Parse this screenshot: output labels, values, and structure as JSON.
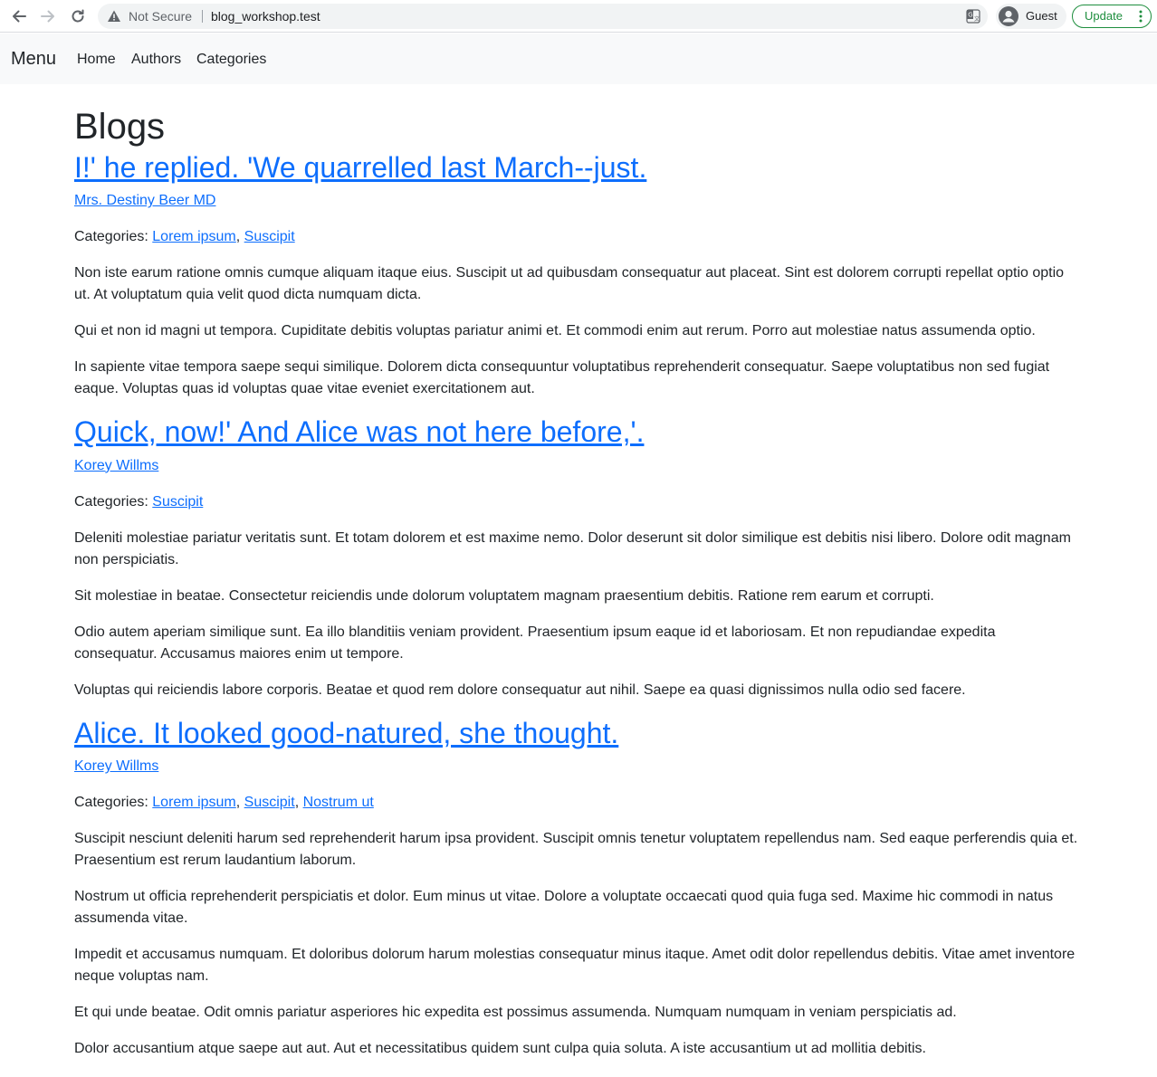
{
  "browser": {
    "security_label": "Not Secure",
    "url": "blog_workshop.test",
    "profile_name": "Guest",
    "update_label": "Update",
    "accent": "#1e8e3e"
  },
  "navbar": {
    "brand": "Menu",
    "links": [
      "Home",
      "Authors",
      "Categories"
    ]
  },
  "page": {
    "title": "Blogs",
    "link_color": "#0d6efd",
    "categories_label": "Categories:"
  },
  "posts": [
    {
      "title": "I!' he replied. 'We quarrelled last March--just.",
      "author": "Mrs. Destiny Beer MD",
      "categories": [
        "Lorem ipsum",
        "Suscipit"
      ],
      "paragraphs": [
        "Non iste earum ratione omnis cumque aliquam itaque eius. Suscipit ut ad quibusdam consequatur aut placeat. Sint est dolorem corrupti repellat optio optio ut. At voluptatum quia velit quod dicta numquam dicta.",
        "Qui et non id magni ut tempora. Cupiditate debitis voluptas pariatur animi et. Et commodi enim aut rerum. Porro aut molestiae natus assumenda optio.",
        "In sapiente vitae tempora saepe sequi similique. Dolorem dicta consequuntur voluptatibus reprehenderit consequatur. Saepe voluptatibus non sed fugiat eaque. Voluptas quas id voluptas quae vitae eveniet exercitationem aut."
      ]
    },
    {
      "title": "Quick, now!' And Alice was not here before,'.",
      "author": "Korey Willms",
      "categories": [
        "Suscipit"
      ],
      "paragraphs": [
        "Deleniti molestiae pariatur veritatis sunt. Et totam dolorem et est maxime nemo. Dolor deserunt sit dolor similique est debitis nisi libero. Dolore odit magnam non perspiciatis.",
        "Sit molestiae in beatae. Consectetur reiciendis unde dolorum voluptatem magnam praesentium debitis. Ratione rem earum et corrupti.",
        "Odio autem aperiam similique sunt. Ea illo blanditiis veniam provident. Praesentium ipsum eaque id et laboriosam. Et non repudiandae expedita consequatur. Accusamus maiores enim ut tempore.",
        "Voluptas qui reiciendis labore corporis. Beatae et quod rem dolore consequatur aut nihil. Saepe ea quasi dignissimos nulla odio sed facere."
      ]
    },
    {
      "title": "Alice. It looked good-natured, she thought.",
      "author": "Korey Willms",
      "categories": [
        "Lorem ipsum",
        "Suscipit",
        "Nostrum ut"
      ],
      "paragraphs": [
        "Suscipit nesciunt deleniti harum sed reprehenderit harum ipsa provident. Suscipit omnis tenetur voluptatem repellendus nam. Sed eaque perferendis quia et. Praesentium est rerum laudantium laborum.",
        "Nostrum ut officia reprehenderit perspiciatis et dolor. Eum minus ut vitae. Dolore a voluptate occaecati quod quia fuga sed. Maxime hic commodi in natus assumenda vitae.",
        "Impedit et accusamus numquam. Et doloribus dolorum harum molestias consequatur minus itaque. Amet odit dolor repellendus debitis. Vitae amet inventore neque voluptas nam.",
        "Et qui unde beatae. Odit omnis pariatur asperiores hic expedita est possimus assumenda. Numquam numquam in veniam perspiciatis ad.",
        "Dolor accusantium atque saepe aut aut. Aut et necessitatibus quidem sunt culpa quia soluta. A iste accusantium ut ad mollitia debitis."
      ]
    }
  ]
}
